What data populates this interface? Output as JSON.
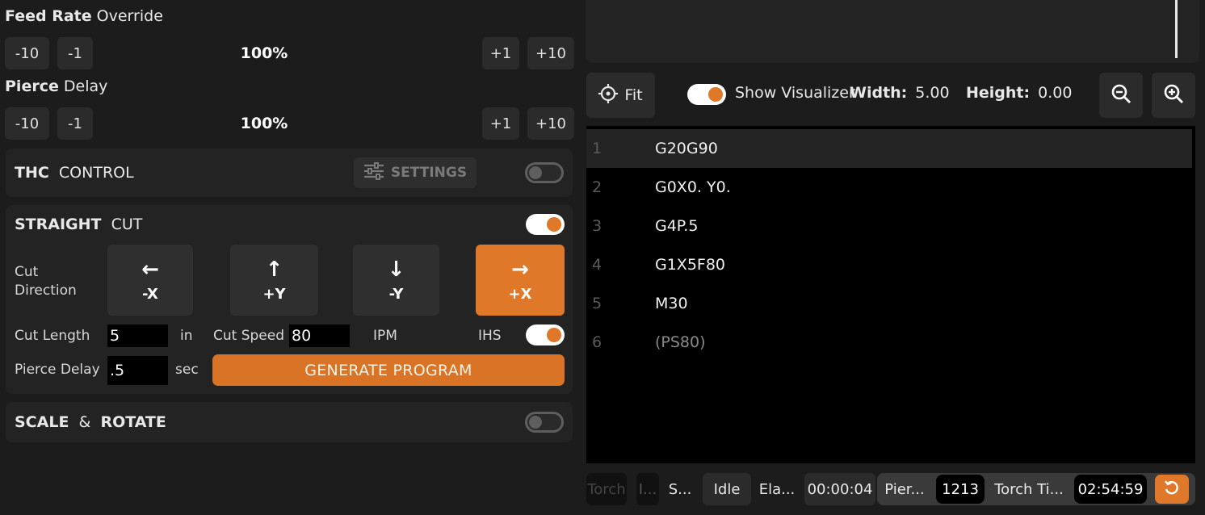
{
  "feed_rate": {
    "title_bold": "Feed Rate",
    "title_rest": "Override",
    "dec10": "-10",
    "dec1": "-1",
    "value": "100%",
    "inc1": "+1",
    "inc10": "+10"
  },
  "pierce": {
    "title_bold": "Pierce",
    "title_rest": "Delay",
    "dec10": "-10",
    "dec1": "-1",
    "value": "100%",
    "inc1": "+1",
    "inc10": "+10"
  },
  "thc": {
    "title_bold": "THC",
    "title_rest": "CONTROL",
    "settings_label": "SETTINGS",
    "enabled": false
  },
  "straight_cut": {
    "title_bold": "STRAIGHT",
    "title_rest": "CUT",
    "enabled": true,
    "direction_label_1": "Cut",
    "direction_label_2": "Direction",
    "directions": [
      {
        "arrow": "←",
        "label": "-X",
        "active": false
      },
      {
        "arrow": "↑",
        "label": "+Y",
        "active": false
      },
      {
        "arrow": "↓",
        "label": "-Y",
        "active": false
      },
      {
        "arrow": "→",
        "label": "+X",
        "active": true
      }
    ],
    "cut_length_label": "Cut Length",
    "cut_length_value": "5",
    "cut_length_unit": "in",
    "cut_speed_label": "Cut Speed",
    "cut_speed_value": "80",
    "cut_speed_unit": "IPM",
    "ihs_label": "IHS",
    "ihs_enabled": true,
    "pierce_delay_label": "Pierce Delay",
    "pierce_delay_value": ".5",
    "pierce_delay_unit": "sec",
    "generate_label": "GENERATE PROGRAM"
  },
  "scale_rotate": {
    "title_bold_1": "SCALE",
    "amp": "&",
    "title_bold_2": "ROTATE",
    "enabled": false
  },
  "visualizer": {
    "fit_label": "Fit",
    "show_label": "Show Visualizer",
    "show_enabled": true,
    "width_label": "Width:",
    "width_value": "5.00",
    "height_label": "Height:",
    "height_value": "0.00"
  },
  "gcode": [
    {
      "line": "1",
      "text": "G20G90"
    },
    {
      "line": "2",
      "text": "G0X0. Y0."
    },
    {
      "line": "3",
      "text": "G4P.5"
    },
    {
      "line": "4",
      "text": "G1X5F80"
    },
    {
      "line": "5",
      "text": "M30"
    },
    {
      "line": "6",
      "text": "(PS80)"
    }
  ],
  "statusbar": {
    "torch": "Torch",
    "i": "I...",
    "s": "S...",
    "state": "Idle",
    "elapsed_label": "Ela...",
    "elapsed_value": "00:00:04",
    "pierce_label": "Pier...",
    "pierce_count": "1213",
    "torch_time_label": "Torch Ti...",
    "torch_time_value": "02:54:59"
  },
  "colors": {
    "accent": "#e0782a",
    "panel": "#232323",
    "background": "#1c1c1c"
  }
}
